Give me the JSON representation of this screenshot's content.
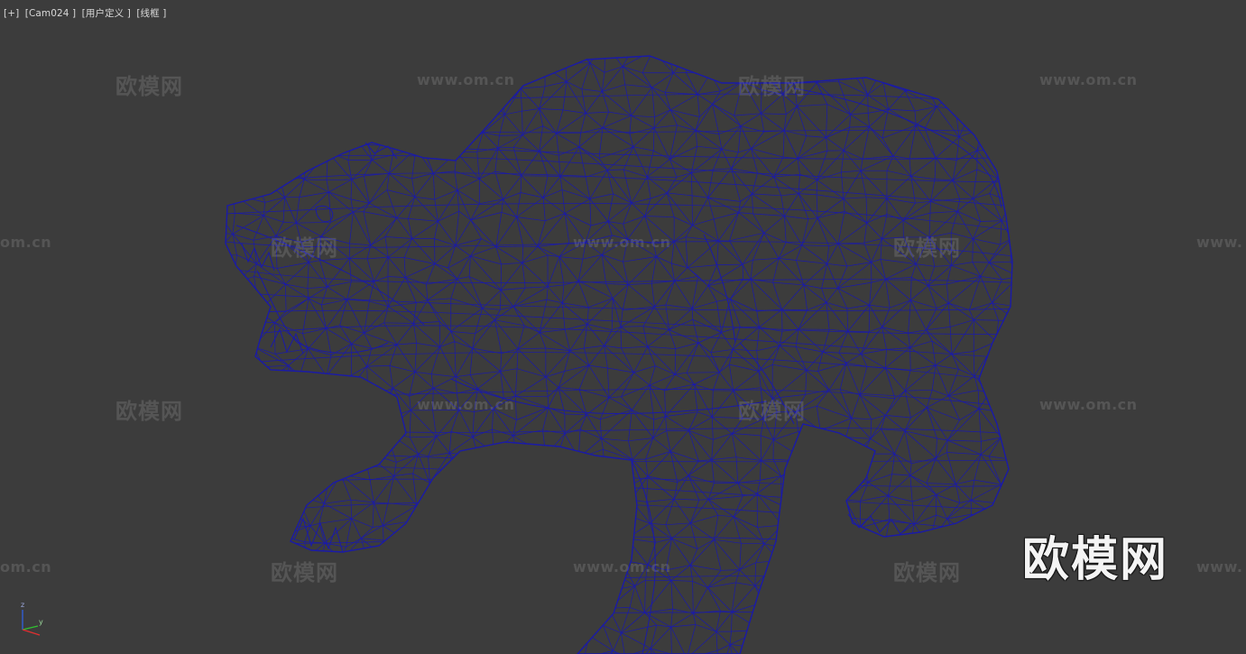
{
  "viewport": {
    "label_parts": [
      "[+]",
      "[Cam024 ]",
      "[用户定义 ]",
      "[线框 ]"
    ],
    "background": "#3c3c3c",
    "wireframe_color": "#1a1aa8"
  },
  "watermarks": {
    "cn": "欧模网",
    "url": "www.om.cn",
    "url_partial_left": "om.cn",
    "url_partial_right": "www."
  },
  "logo_overlay": {
    "text": "欧模网"
  },
  "axis_gizmo": {
    "z": "z",
    "y": "y",
    "x_color": "#e03030",
    "y_color": "#30c030",
    "z_color": "#3060e0"
  }
}
